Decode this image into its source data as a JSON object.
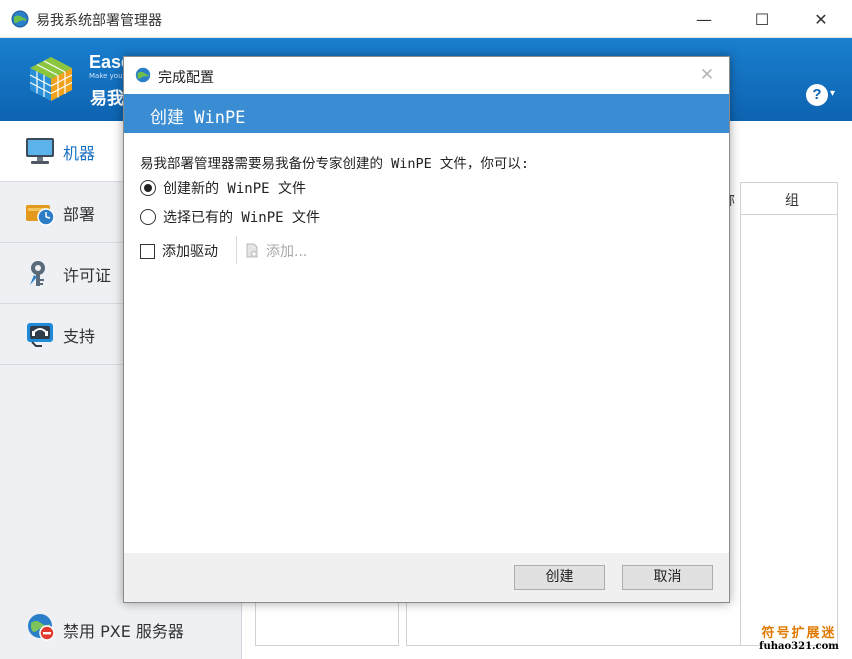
{
  "window": {
    "title": "易我系统部署管理器",
    "minimize_glyph": "—",
    "maximize_glyph": "☐",
    "close_glyph": "✕"
  },
  "banner": {
    "brand": "Ease",
    "brand_sub": "Make your",
    "brand_cn": "易我",
    "help_glyph": "?",
    "help_caret": "▾",
    "colors": {
      "top": "#1a7fd0",
      "bottom": "#0d63b0"
    }
  },
  "sidebar": {
    "items": [
      {
        "label": "机器",
        "icon": "monitor-icon",
        "active": true
      },
      {
        "label": "部署",
        "icon": "deploy-clock-icon",
        "active": false
      },
      {
        "label": "许可证",
        "icon": "license-key-icon",
        "active": false
      },
      {
        "label": "支持",
        "icon": "support-headset-icon",
        "active": false
      }
    ],
    "pxe_label": "禁用 PXE 服务器",
    "pxe_icon": "globe-disable-icon"
  },
  "table": {
    "partial_header": "称",
    "group_header": "组"
  },
  "watermark": {
    "line1": "符号扩展迷",
    "line2": "fuhao321.com"
  },
  "dialog": {
    "title": "完成配置",
    "close_glyph": "✕",
    "header": "创建 WinPE",
    "header_color": "#3a8dd3",
    "message": "易我部署管理器需要易我备份专家创建的 WinPE 文件，你可以:",
    "options": [
      {
        "label": "创建新的 WinPE 文件",
        "checked": true
      },
      {
        "label": "选择已有的 WinPE 文件",
        "checked": false
      }
    ],
    "add_driver_label": "添加驱动",
    "add_driver_checked": false,
    "add_label": "添加...",
    "create_button": "创建",
    "cancel_button": "取消"
  }
}
